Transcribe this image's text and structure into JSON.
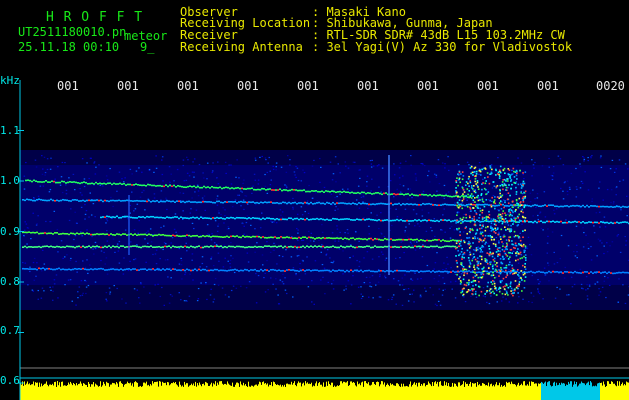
{
  "header": {
    "app_title": "H R O F F T",
    "filename": "UT2511180010.pn",
    "mode": "meteor",
    "datetime": "25.11.18 00:10",
    "extra": "9_",
    "rows": [
      {
        "label": "Observer",
        "value": ": Masaki Kano"
      },
      {
        "label": "Receiving Location",
        "value": ": Shibukawa, Gunma, Japan"
      },
      {
        "label": "Receiver",
        "value": ": RTL-SDR SDR# 43dB L15 103.2MHz CW"
      },
      {
        "label": "Receiving Antenna",
        "value": ": 3el Yagi(V) Az 330 for Vladivostok"
      }
    ]
  },
  "time_axis": {
    "labels": [
      "001",
      "001",
      "001",
      "001",
      "001",
      "001",
      "001",
      "001",
      "001",
      "0020"
    ]
  },
  "freq_axis": {
    "unit": "kHz",
    "ticks": [
      {
        "label": "1.1",
        "value": 1.1
      },
      {
        "label": "1.0",
        "value": 1.0
      },
      {
        "label": "0.9",
        "value": 0.9
      },
      {
        "label": "0.8",
        "value": 0.8
      },
      {
        "label": "0.7",
        "value": 0.7
      },
      {
        "label": "0.6",
        "value": 0.6
      }
    ]
  },
  "colors": {
    "title": "#18e818",
    "info": "#e8e800",
    "axis": "#00e8e8",
    "background": "#000000",
    "spectrogram_base": "#00007a",
    "level_bar": "#ffff00",
    "level_bar_alt": "#00c8e8"
  }
}
